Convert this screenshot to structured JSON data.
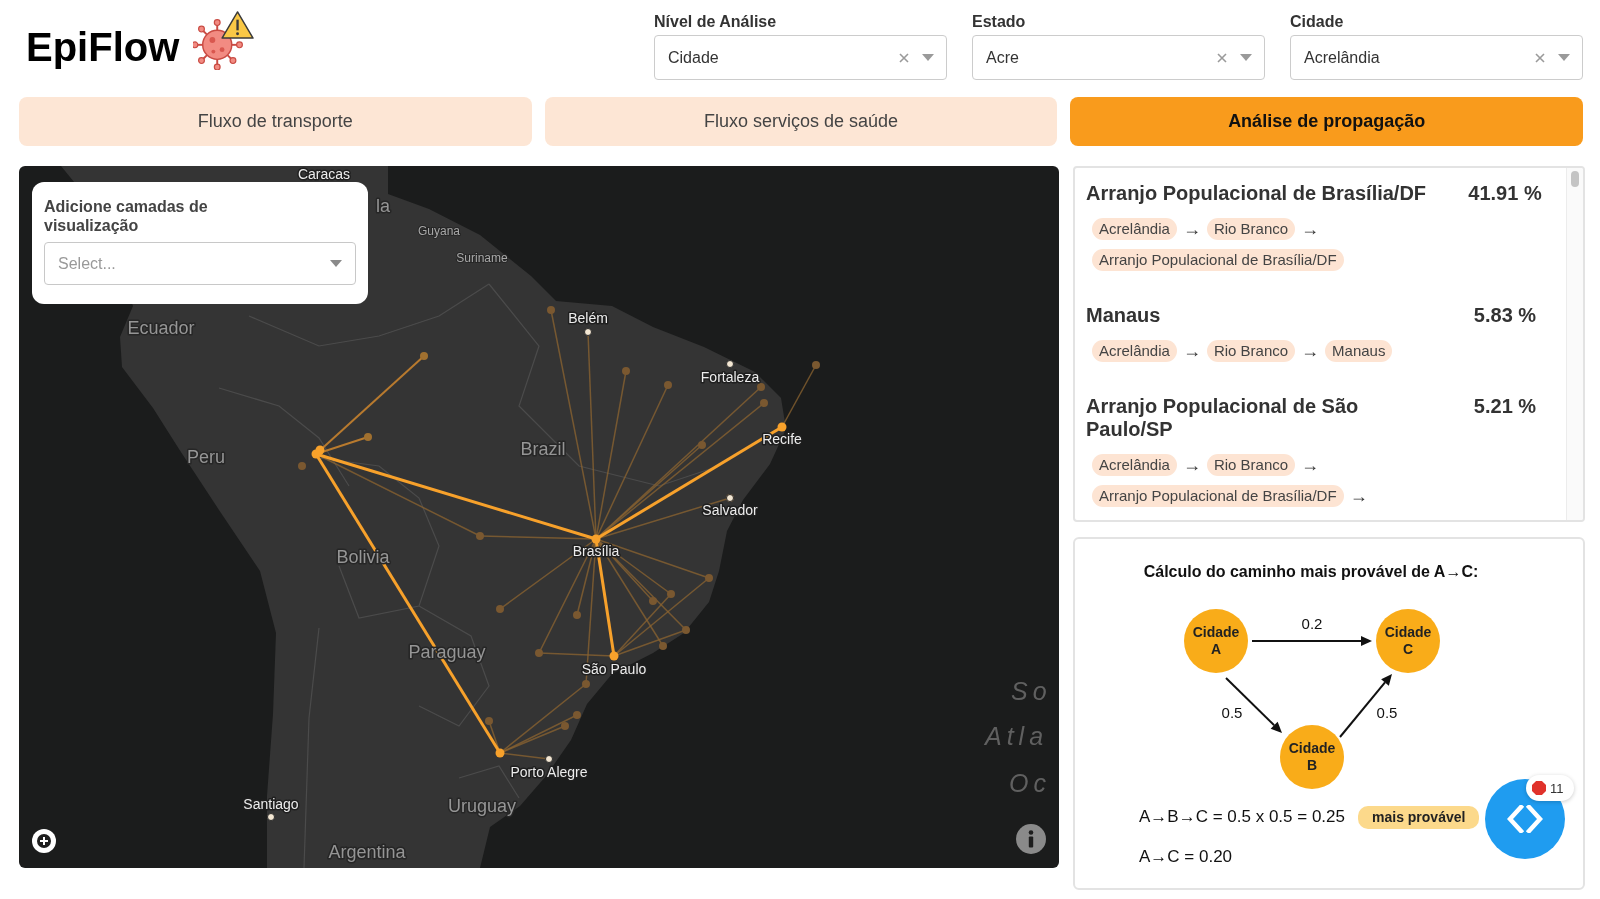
{
  "header": {
    "logo": "EpiFlow",
    "filters": [
      {
        "label": "Nível de Análise",
        "value": "Cidade"
      },
      {
        "label": "Estado",
        "value": "Acre"
      },
      {
        "label": "Cidade",
        "value": "Acrelândia"
      }
    ]
  },
  "tabs": [
    {
      "label": "Fluxo de transporte",
      "selected": false
    },
    {
      "label": "Fluxo serviços de saúde",
      "selected": false
    },
    {
      "label": "Análise de propagação",
      "selected": true
    }
  ],
  "map": {
    "layer_control": {
      "label": "Adicione camadas de visualização",
      "placeholder": "Select..."
    },
    "labels": [
      {
        "text": "Caracas",
        "kind": "hub"
      },
      {
        "text": "la",
        "kind": "country"
      },
      {
        "text": "Guyana",
        "kind": "region"
      },
      {
        "text": "Suriname",
        "kind": "region"
      },
      {
        "text": "Ecuador",
        "kind": "country"
      },
      {
        "text": "Belém",
        "kind": "city"
      },
      {
        "text": "Fortaleza",
        "kind": "city"
      },
      {
        "text": "Peru",
        "kind": "country"
      },
      {
        "text": "Brazil",
        "kind": "country"
      },
      {
        "text": "Recife",
        "kind": "hub"
      },
      {
        "text": "Salvador",
        "kind": "city"
      },
      {
        "text": "Bolivia",
        "kind": "country"
      },
      {
        "text": "Brasília",
        "kind": "hub"
      },
      {
        "text": "Paraguay",
        "kind": "country"
      },
      {
        "text": "São Paulo",
        "kind": "hub"
      },
      {
        "text": "Porto Alegre",
        "kind": "city"
      },
      {
        "text": "Santiago",
        "kind": "city"
      },
      {
        "text": "Uruguay",
        "kind": "country"
      },
      {
        "text": "Argentina",
        "kind": "country"
      },
      {
        "text": "So",
        "kind": "ocean"
      },
      {
        "text": "Atla",
        "kind": "ocean"
      },
      {
        "text": "Oc",
        "kind": "ocean"
      }
    ]
  },
  "results": [
    {
      "destination": "Arranjo Populacional de Brasília/DF",
      "percent": "41.91 %",
      "path": [
        {
          "kind": "place",
          "text": "Acrelândia"
        },
        {
          "kind": "arrow",
          "text": "→"
        },
        {
          "kind": "place",
          "text": "Rio Branco"
        },
        {
          "kind": "arrow",
          "text": "→"
        },
        {
          "kind": "place",
          "text": "Arranjo Populacional de Brasília/DF"
        }
      ]
    },
    {
      "destination": "Manaus",
      "percent": "5.83 %",
      "path": [
        {
          "kind": "place",
          "text": "Acrelândia"
        },
        {
          "kind": "arrow",
          "text": "→"
        },
        {
          "kind": "place",
          "text": "Rio Branco"
        },
        {
          "kind": "arrow",
          "text": "→"
        },
        {
          "kind": "place",
          "text": "Manaus"
        }
      ]
    },
    {
      "destination": "Arranjo Populacional de São Paulo/SP",
      "percent": "5.21 %",
      "path": [
        {
          "kind": "place",
          "text": "Acrelândia"
        },
        {
          "kind": "arrow",
          "text": "→"
        },
        {
          "kind": "place",
          "text": "Rio Branco"
        },
        {
          "kind": "arrow",
          "text": "→"
        },
        {
          "kind": "place",
          "text": "Arranjo Populacional de Brasília/DF"
        },
        {
          "kind": "arrow",
          "text": "→"
        }
      ]
    }
  ],
  "diagram": {
    "title": "Cálculo do caminho mais provável de A→C:",
    "nodes": [
      {
        "label": "Cidade A"
      },
      {
        "label": "Cidade C"
      },
      {
        "label": "Cidade B"
      }
    ],
    "edges": [
      {
        "label": "0.2"
      },
      {
        "label": "0.5"
      },
      {
        "label": "0.5"
      }
    ],
    "formulas": [
      {
        "text": "A→B→C = 0.5 x 0.5 = 0.25",
        "badge": "mais provável"
      },
      {
        "text": "A→C = 0.20"
      }
    ]
  },
  "debug_button": {
    "error_count": "11"
  }
}
